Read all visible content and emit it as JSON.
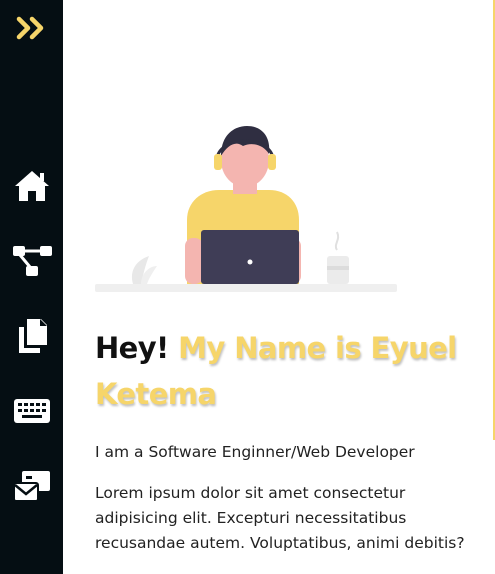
{
  "colors": {
    "accent": "#f6d56a",
    "sidebar_bg": "#050e13",
    "text": "#111111"
  },
  "sidebar": {
    "toggle_icon": "double-chevron-right-icon",
    "items": [
      {
        "icon": "home-icon"
      },
      {
        "icon": "project-tree-icon"
      },
      {
        "icon": "documents-icon"
      },
      {
        "icon": "keyboard-icon"
      },
      {
        "icon": "contact-mail-icon"
      }
    ]
  },
  "hero": {
    "greeting": "Hey!",
    "name_line": "My Name is Eyuel Ketema",
    "subtitle": "I am a Software Enginner/Web Developer",
    "description": "Lorem ipsum dolor sit amet consectetur adipisicing elit. Excepturi necessitatibus recusandae autem. Voluptatibus, animi debitis?"
  }
}
